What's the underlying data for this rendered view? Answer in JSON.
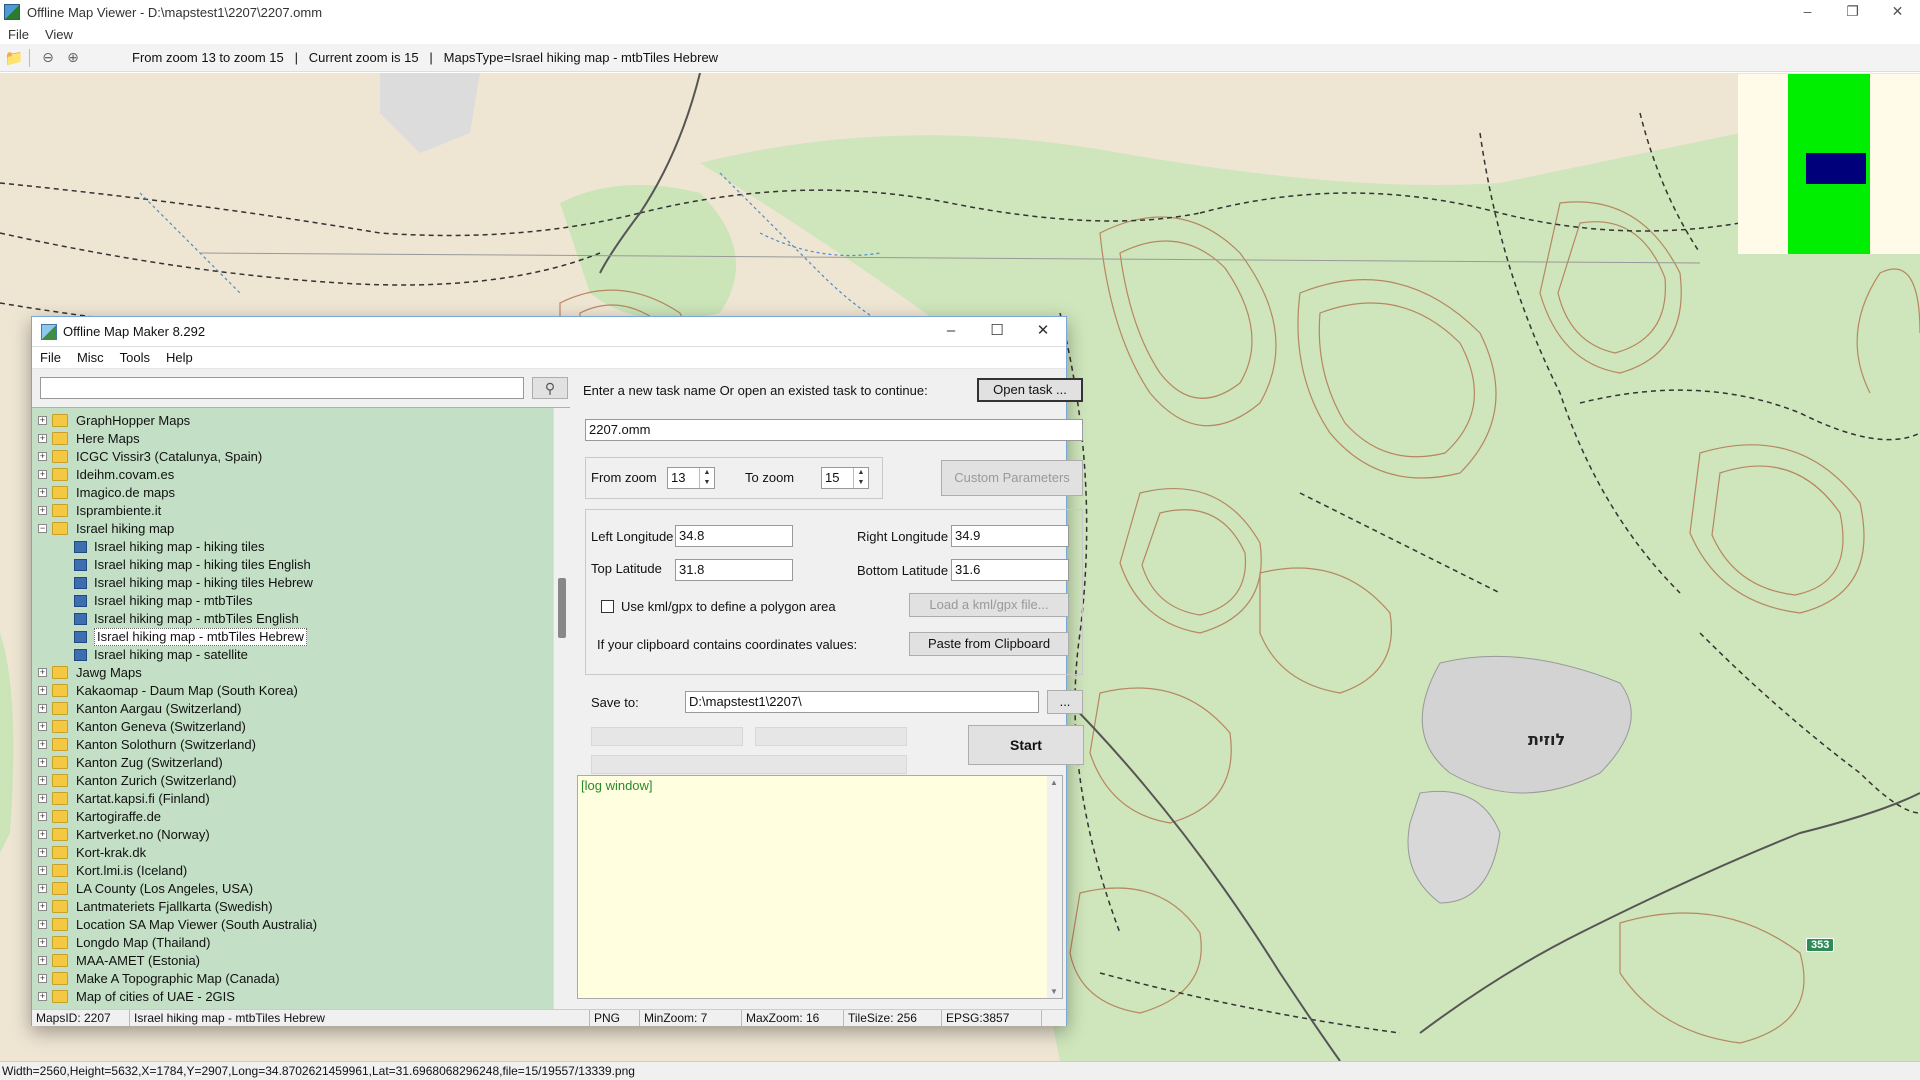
{
  "window": {
    "title": "Offline Map Viewer - D:\\mapstest1\\2207\\2207.omm"
  },
  "menubar": {
    "file": "File",
    "view": "View"
  },
  "toolbar": {
    "status": "From zoom 13 to zoom 15   |   Current zoom is 15   |   MapsType=Israel hiking map - mtbTiles Hebrew"
  },
  "map": {
    "city_label": "לוזית",
    "road_number": "353"
  },
  "status_bar": "Width=2560,Height=5632,X=1784,Y=2907,Long=34.8702621459961,Lat=31.6968068296248,file=15/19557/13339.png",
  "dialog": {
    "title": "Offline Map Maker 8.292",
    "menu": {
      "file": "File",
      "misc": "Misc",
      "tools": "Tools",
      "help": "Help"
    },
    "search": {
      "value": "",
      "icon": "search-icon"
    },
    "tree": [
      {
        "label": "GraphHopper Maps",
        "level": 0,
        "type": "folder",
        "expanded": false
      },
      {
        "label": "Here Maps",
        "level": 0,
        "type": "folder",
        "expanded": false
      },
      {
        "label": "ICGC Vissir3 (Catalunya, Spain)",
        "level": 0,
        "type": "folder",
        "expanded": false
      },
      {
        "label": "Ideihm.covam.es",
        "level": 0,
        "type": "folder",
        "expanded": false
      },
      {
        "label": "Imagico.de maps",
        "level": 0,
        "type": "folder",
        "expanded": false
      },
      {
        "label": "Isprambiente.it",
        "level": 0,
        "type": "folder",
        "expanded": false
      },
      {
        "label": "Israel hiking map",
        "level": 0,
        "type": "folder",
        "expanded": true
      },
      {
        "label": "Israel hiking map - hiking tiles",
        "level": 1,
        "type": "map"
      },
      {
        "label": "Israel hiking map - hiking tiles English",
        "level": 1,
        "type": "map"
      },
      {
        "label": "Israel hiking map - hiking tiles Hebrew",
        "level": 1,
        "type": "map"
      },
      {
        "label": "Israel hiking map - mtbTiles",
        "level": 1,
        "type": "map"
      },
      {
        "label": "Israel hiking map - mtbTiles English",
        "level": 1,
        "type": "map"
      },
      {
        "label": "Israel hiking map - mtbTiles Hebrew",
        "level": 1,
        "type": "map",
        "selected": true
      },
      {
        "label": "Israel hiking map - satellite",
        "level": 1,
        "type": "map"
      },
      {
        "label": "Jawg Maps",
        "level": 0,
        "type": "folder",
        "expanded": false
      },
      {
        "label": "Kakaomap - Daum Map (South Korea)",
        "level": 0,
        "type": "folder",
        "expanded": false
      },
      {
        "label": "Kanton Aargau (Switzerland)",
        "level": 0,
        "type": "folder",
        "expanded": false
      },
      {
        "label": "Kanton Geneva (Switzerland)",
        "level": 0,
        "type": "folder",
        "expanded": false
      },
      {
        "label": "Kanton Solothurn (Switzerland)",
        "level": 0,
        "type": "folder",
        "expanded": false
      },
      {
        "label": "Kanton Zug (Switzerland)",
        "level": 0,
        "type": "folder",
        "expanded": false
      },
      {
        "label": "Kanton Zurich (Switzerland)",
        "level": 0,
        "type": "folder",
        "expanded": false
      },
      {
        "label": "Kartat.kapsi.fi (Finland)",
        "level": 0,
        "type": "folder",
        "expanded": false
      },
      {
        "label": "Kartogiraffe.de",
        "level": 0,
        "type": "folder",
        "expanded": false
      },
      {
        "label": "Kartverket.no (Norway)",
        "level": 0,
        "type": "folder",
        "expanded": false
      },
      {
        "label": "Kort-krak.dk",
        "level": 0,
        "type": "folder",
        "expanded": false
      },
      {
        "label": "Kort.lmi.is (Iceland)",
        "level": 0,
        "type": "folder",
        "expanded": false
      },
      {
        "label": "LA County (Los Angeles, USA)",
        "level": 0,
        "type": "folder",
        "expanded": false
      },
      {
        "label": "Lantmateriets Fjallkarta (Swedish)",
        "level": 0,
        "type": "folder",
        "expanded": false
      },
      {
        "label": "Location SA Map Viewer (South Australia)",
        "level": 0,
        "type": "folder",
        "expanded": false
      },
      {
        "label": "Longdo Map (Thailand)",
        "level": 0,
        "type": "folder",
        "expanded": false
      },
      {
        "label": "MAA-AMET (Estonia)",
        "level": 0,
        "type": "folder",
        "expanded": false
      },
      {
        "label": "Make A Topographic Map (Canada)",
        "level": 0,
        "type": "folder",
        "expanded": false
      },
      {
        "label": "Map of cities of UAE - 2GIS",
        "level": 0,
        "type": "folder",
        "expanded": false
      }
    ],
    "task": {
      "prompt": "Enter a new task name Or open an existed task to continue:",
      "open_button": "Open task ...",
      "task_name": "2207.omm"
    },
    "zoom": {
      "from_label": "From zoom",
      "from_value": "13",
      "to_label": "To zoom",
      "to_value": "15",
      "custom_button": "Custom Parameters"
    },
    "coords": {
      "left_lon_label": "Left Longitude",
      "left_lon": "34.8",
      "right_lon_label": "Right Longitude",
      "right_lon": "34.9",
      "top_lat_label": "Top Latitude",
      "top_lat": "31.8",
      "bottom_lat_label": "Bottom Latitude",
      "bottom_lat": "31.6",
      "kml_label": "Use kml/gpx to define a polygon area",
      "kml_checked": false,
      "kml_button": "Load a kml/gpx file...",
      "clipboard_label": "If your clipboard contains coordinates values:",
      "clipboard_button": "Paste from Clipboard"
    },
    "save": {
      "label": "Save to:",
      "path": "D:\\mapstest1\\2207\\",
      "browse_button": "...",
      "start_button": "Start"
    },
    "log": {
      "text": "[log window]"
    },
    "status": {
      "maps_id": "MapsID: 2207",
      "map_name": "Israel hiking map - mtbTiles Hebrew",
      "format": "PNG",
      "min_zoom": "MinZoom: 7",
      "max_zoom": "MaxZoom: 16",
      "tile_size": "TileSize: 256",
      "epsg": "EPSG:3857"
    }
  },
  "colors": {
    "map_bg": "#efe5d3",
    "forest": "#c8e3b5",
    "contour": "#a0522d",
    "tree_bg": "#c3dfc5",
    "log_bg": "#ffffe0",
    "minimap_green": "#00ee00",
    "minimap_blue": "#00007a"
  }
}
